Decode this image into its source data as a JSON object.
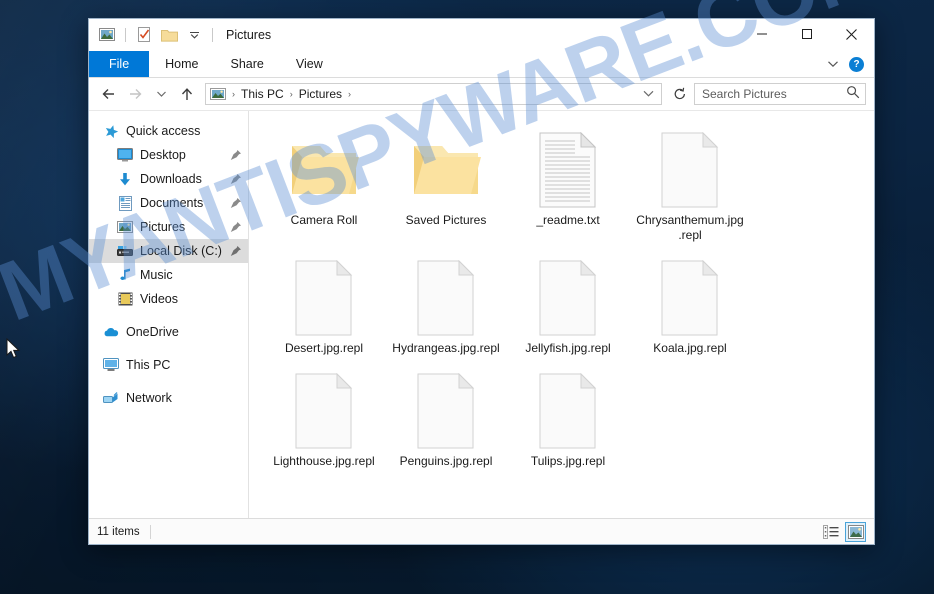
{
  "desktop": {
    "watermark_text": "MYANTISPYWARE.COM",
    "watermark_color": "#5b8fd4",
    "background_color": "#0b2441",
    "cursor_name": "mouse-pointer"
  },
  "window": {
    "title": "Pictures",
    "quick_access": [
      {
        "name": "pictures-library-icon",
        "label": "Pictures library"
      },
      {
        "name": "properties-icon",
        "label": "Properties"
      },
      {
        "name": "new-folder-icon",
        "label": "New folder"
      },
      {
        "name": "customize-quick-access-icon",
        "label": "Customize Quick Access Toolbar"
      }
    ],
    "controls": {
      "minimize": "—",
      "maximize": "□",
      "close": "✕"
    }
  },
  "ribbon": {
    "tabs": [
      {
        "label": "File",
        "active": true
      },
      {
        "label": "Home",
        "active": false
      },
      {
        "label": "Share",
        "active": false
      },
      {
        "label": "View",
        "active": false
      }
    ],
    "expand_label": "⌄",
    "help_label": "?"
  },
  "address": {
    "back_icon": "arrow-left-icon",
    "forward_icon": "arrow-right-icon",
    "recent_icon": "chevron-down-icon",
    "up_icon": "arrow-up-icon",
    "crumb_icon": "pictures-icon",
    "crumbs": [
      "This PC",
      "Pictures"
    ],
    "separator": "›",
    "dropdown_icon": "chevron-down-icon",
    "refresh_icon": "refresh-icon"
  },
  "search": {
    "placeholder": "Search Pictures",
    "value": "",
    "icon": "search-icon"
  },
  "sidebar": {
    "items": [
      {
        "label": "Quick access",
        "icon": "star-icon",
        "level": 0,
        "pinned": false,
        "selected": false
      },
      {
        "label": "Desktop",
        "icon": "desktop-icon",
        "level": 1,
        "pinned": true,
        "selected": false
      },
      {
        "label": "Downloads",
        "icon": "download-arrow-icon",
        "level": 1,
        "pinned": true,
        "selected": false
      },
      {
        "label": "Documents",
        "icon": "documents-icon",
        "level": 1,
        "pinned": true,
        "selected": false
      },
      {
        "label": "Pictures",
        "icon": "pictures-icon",
        "level": 1,
        "pinned": true,
        "selected": false
      },
      {
        "label": "Local Disk (C:)",
        "icon": "hard-disk-icon",
        "level": 1,
        "pinned": true,
        "selected": true
      },
      {
        "label": "Music",
        "icon": "music-note-icon",
        "level": 1,
        "pinned": false,
        "selected": false
      },
      {
        "label": "Videos",
        "icon": "video-film-icon",
        "level": 1,
        "pinned": false,
        "selected": false
      },
      {
        "label": "OneDrive",
        "icon": "cloud-icon",
        "level": 0,
        "pinned": false,
        "selected": false
      },
      {
        "label": "This PC",
        "icon": "this-pc-icon",
        "level": 0,
        "pinned": false,
        "selected": false
      },
      {
        "label": "Network",
        "icon": "network-icon",
        "level": 0,
        "pinned": false,
        "selected": false
      }
    ]
  },
  "files": [
    {
      "name": "Camera Roll",
      "type": "folder"
    },
    {
      "name": "Saved Pictures",
      "type": "folder"
    },
    {
      "name": "_readme.txt",
      "type": "text"
    },
    {
      "name": "Chrysanthemum.jpg.repl",
      "type": "blank"
    },
    {
      "name": "Desert.jpg.repl",
      "type": "blank"
    },
    {
      "name": "Hydrangeas.jpg.repl",
      "type": "blank"
    },
    {
      "name": "Jellyfish.jpg.repl",
      "type": "blank"
    },
    {
      "name": "Koala.jpg.repl",
      "type": "blank"
    },
    {
      "name": "Lighthouse.jpg.repl",
      "type": "blank"
    },
    {
      "name": "Penguins.jpg.repl",
      "type": "blank"
    },
    {
      "name": "Tulips.jpg.repl",
      "type": "blank"
    }
  ],
  "statusbar": {
    "item_count": "11 items",
    "views": [
      {
        "name": "details-view-button",
        "label": "Details view",
        "active": false
      },
      {
        "name": "large-icons-view-button",
        "label": "Large icons view",
        "active": true
      }
    ]
  }
}
